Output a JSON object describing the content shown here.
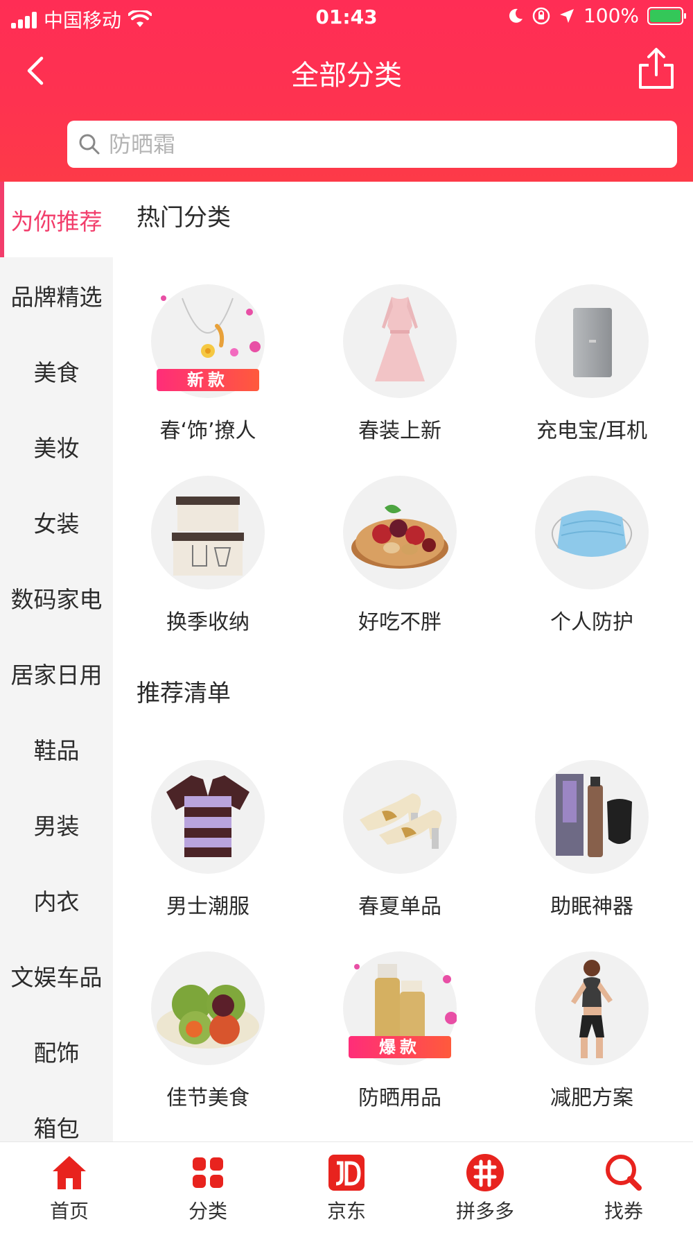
{
  "status_bar": {
    "carrier": "中国移动",
    "time": "01:43",
    "battery": "100%"
  },
  "nav": {
    "title": "全部分类"
  },
  "search": {
    "placeholder": "防晒霜"
  },
  "sidebar": {
    "items": [
      {
        "label": "为你推荐",
        "active": true
      },
      {
        "label": "品牌精选"
      },
      {
        "label": "美食"
      },
      {
        "label": "美妆"
      },
      {
        "label": "女装"
      },
      {
        "label": "数码家电"
      },
      {
        "label": "居家日用"
      },
      {
        "label": "鞋品"
      },
      {
        "label": "男装"
      },
      {
        "label": "内衣"
      },
      {
        "label": "文娱车品"
      },
      {
        "label": "配饰"
      },
      {
        "label": "箱包"
      }
    ]
  },
  "sections": [
    {
      "title": "热门分类",
      "items": [
        {
          "label": "春‘饰’撩人",
          "badge": "新款",
          "icon": "necklace-icon"
        },
        {
          "label": "春装上新",
          "icon": "dress-icon"
        },
        {
          "label": "充电宝/耳机",
          "icon": "power-bank-icon"
        },
        {
          "label": "换季收纳",
          "icon": "storage-box-icon"
        },
        {
          "label": "好吃不胖",
          "icon": "nuts-icon"
        },
        {
          "label": "个人防护",
          "icon": "mask-icon"
        }
      ]
    },
    {
      "title": "推荐清单",
      "items": [
        {
          "label": "男士潮服",
          "icon": "polo-shirt-icon"
        },
        {
          "label": "春夏单品",
          "icon": "heels-icon"
        },
        {
          "label": "助眠神器",
          "icon": "sleep-mask-icon"
        },
        {
          "label": "佳节美食",
          "icon": "dumplings-icon"
        },
        {
          "label": "防晒用品",
          "badge": "爆款",
          "icon": "sunscreen-icon"
        },
        {
          "label": "减肥方案",
          "icon": "fitness-icon"
        }
      ]
    }
  ],
  "tabbar": {
    "items": [
      {
        "label": "首页",
        "icon": "home-icon"
      },
      {
        "label": "分类",
        "icon": "category-icon"
      },
      {
        "label": "京东",
        "icon": "jd-icon"
      },
      {
        "label": "拼多多",
        "icon": "pinduoduo-icon"
      },
      {
        "label": "找券",
        "icon": "coupon-search-icon"
      }
    ]
  },
  "colors": {
    "header": "#fe2f52",
    "accent": "#f23d6b",
    "tab_icon": "#e8231e"
  }
}
